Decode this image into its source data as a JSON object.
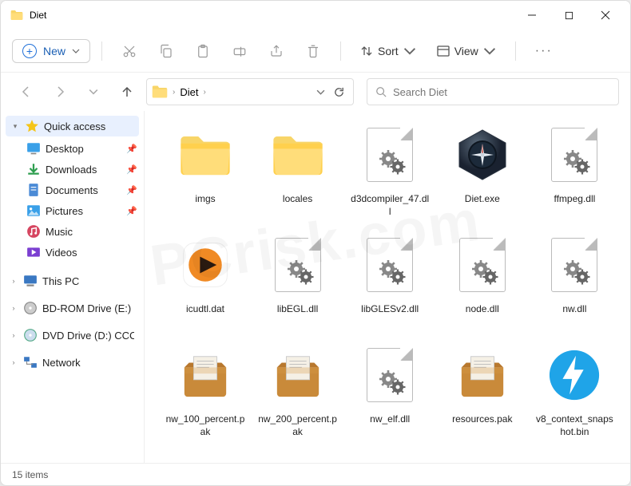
{
  "window": {
    "title": "Diet"
  },
  "toolbar": {
    "new_label": "New",
    "sort_label": "Sort",
    "view_label": "View"
  },
  "breadcrumb": {
    "segment": "Diet"
  },
  "search": {
    "placeholder": "Search Diet"
  },
  "sidebar": {
    "quick_access": "Quick access",
    "items": [
      {
        "label": "Desktop"
      },
      {
        "label": "Downloads"
      },
      {
        "label": "Documents"
      },
      {
        "label": "Pictures"
      },
      {
        "label": "Music"
      },
      {
        "label": "Videos"
      }
    ],
    "drives": [
      {
        "label": "This PC"
      },
      {
        "label": "BD-ROM Drive (E:) C"
      },
      {
        "label": "DVD Drive (D:) CCCC"
      },
      {
        "label": "Network"
      }
    ]
  },
  "files": [
    {
      "name": "imgs",
      "type": "folder"
    },
    {
      "name": "locales",
      "type": "folder"
    },
    {
      "name": "d3dcompiler_47.dll",
      "type": "dll"
    },
    {
      "name": "Diet.exe",
      "type": "exe"
    },
    {
      "name": "ffmpeg.dll",
      "type": "dll"
    },
    {
      "name": "icudtl.dat",
      "type": "dat"
    },
    {
      "name": "libEGL.dll",
      "type": "dll"
    },
    {
      "name": "libGLESv2.dll",
      "type": "dll"
    },
    {
      "name": "node.dll",
      "type": "dll"
    },
    {
      "name": "nw.dll",
      "type": "dll"
    },
    {
      "name": "nw_100_percent.pak",
      "type": "pak"
    },
    {
      "name": "nw_200_percent.pak",
      "type": "pak"
    },
    {
      "name": "nw_elf.dll",
      "type": "dll"
    },
    {
      "name": "resources.pak",
      "type": "pak"
    },
    {
      "name": "v8_context_snapshot.bin",
      "type": "bin"
    }
  ],
  "status": {
    "item_count": "15 items"
  }
}
